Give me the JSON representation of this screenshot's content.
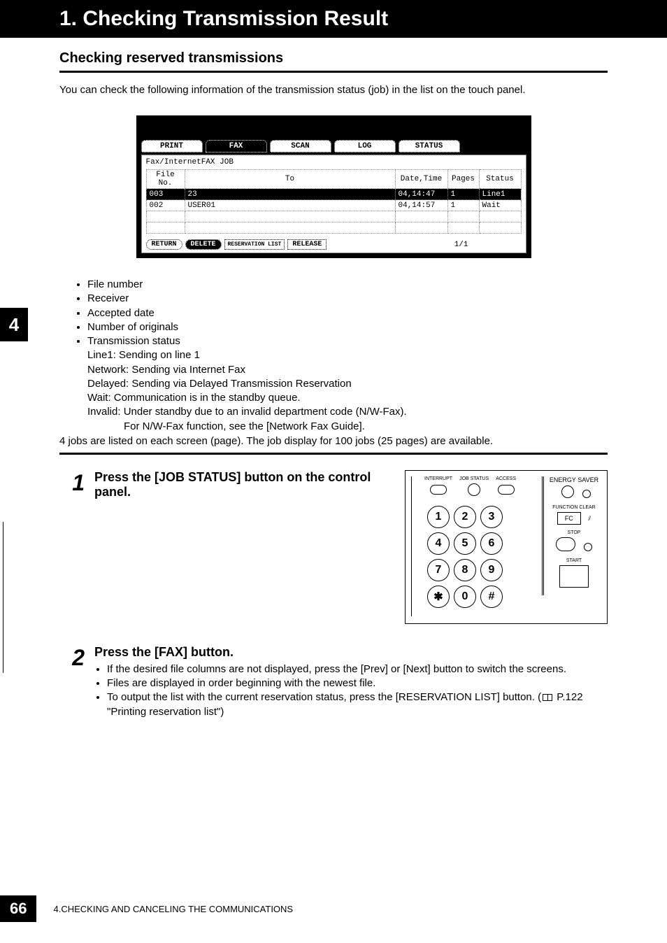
{
  "title": "1. Checking Transmission Result",
  "subtitle": "Checking reserved transmissions",
  "intro": "You can check the following information of the transmission status (job) in the list on the touch panel.",
  "chapter_tab": "4",
  "screen": {
    "tabs": [
      "PRINT",
      "FAX",
      "SCAN",
      "LOG",
      "STATUS"
    ],
    "subtitle": "Fax/InternetFAX JOB",
    "headers": {
      "file": "File No.",
      "to": "To",
      "dt": "Date,Time",
      "pages": "Pages",
      "status": "Status"
    },
    "rows": [
      {
        "file": "003",
        "to": "23",
        "dt": "04,14:47",
        "pages": "1",
        "status": "Line1"
      },
      {
        "file": "002",
        "to": "USER01",
        "dt": "04,14:57",
        "pages": "1",
        "status": "Wait"
      }
    ],
    "buttons": {
      "return": "RETURN",
      "delete": "DELETE",
      "reslist": "RESERVATION LIST",
      "release": "RELEASE"
    },
    "page_indicator": "1/1"
  },
  "bullets": [
    "File number",
    "Receiver",
    "Accepted date",
    "Number of originals",
    "Transmission status"
  ],
  "status_defs": {
    "line1": "Line1: Sending on line 1",
    "network": "Network: Sending via Internet Fax",
    "delayed": "Delayed: Sending via Delayed Transmission Reservation",
    "wait": "Wait: Communication is in the standby queue.",
    "invalid": "Invalid: Under standby due to an invalid department code (N/W-Fax).",
    "nwfax": "For N/W-Fax function, see the [Network Fax Guide]."
  },
  "note_foot": "4 jobs are listed on each screen (page). The job display for 100 jobs (25 pages) are available.",
  "steps": {
    "s1": {
      "num": "1",
      "title": "Press the [JOB STATUS] button on the control panel."
    },
    "s2": {
      "num": "2",
      "title": "Press the [FAX] button.",
      "b1": "If the desired file columns are not displayed, press the [Prev] or [Next] button to switch the screens.",
      "b2": "Files are displayed in order beginning with the newest file.",
      "b3a": "To output the list with the current reservation status, press the [RESERVATION LIST] button. (",
      "b3b": " P.122 \"Printing reservation list\")"
    }
  },
  "panel": {
    "interrupt": "INTERRUPT",
    "jobstatus": "JOB STATUS",
    "access": "ACCESS",
    "energy": "ENERGY SAVER",
    "fclear": "FUNCTION CLEAR",
    "fc": "FC",
    "stop": "STOP",
    "start": "START",
    "keys": [
      "1",
      "2",
      "3",
      "4",
      "5",
      "6",
      "7",
      "8",
      "9",
      "✱",
      "0",
      "#"
    ]
  },
  "footer": {
    "page": "66",
    "chapter": "4.CHECKING AND CANCELING THE COMMUNICATIONS"
  }
}
